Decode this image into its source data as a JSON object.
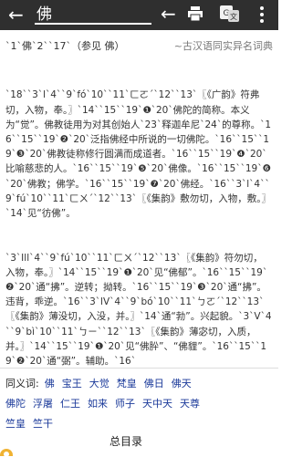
{
  "topbar": {
    "search_text": "佛",
    "back_label": "←",
    "nav_back_label": "←"
  },
  "header": {
    "headword": "`1`佛`2``17`（参见 佛）",
    "source": "~古汉语同实异名词典"
  },
  "content_lines": [
    "`18``3`l`4``9`fó`10``11`ㄈㄛˊ`12``13`〖《广韵》符弗切，入物，奉。〗`14``15``19`❶`20`佛陀的简称。本义为“觉”。佛教徒用为对其创始人`23`释迦牟尼`24`的尊称。`16``15``19`❷`20`泛指佛经中所说的一切佛陀。`16``15``19`❸`20`佛教徒称修行圆满而成道者。`16``15``19`❹`20`比喻慈悲的人。`16``15``19`❺`20`佛像。`16``15``19`❻`20`佛教；佛学。`16``15``19`❼`20`佛经。`16``3`l`4``9`fú`10``11`ㄈㄨˊ`12``13`〖《集韵》敷勿切，入物，敷。〗`14`见“彷佛”。",
    "`3`Ill`4``9`fú`10``11`ㄈㄨˊ`12``13`〖《集韵》符勿切，入物，奉。〗`14``15``19`❶`20`见“佛郁”。`16``15``19`❷`20`通“拂”。逆转；拗转。`16``15``19`❸`20`通“拂”。违背，乖逆。`16``3`lV`4``9`bó`10``11`ㄅㄛˊ`12``13`〖《集韵》薄没切，入没，并。〗`14`通“勃”。兴起貌。`3`V`4``9`bì`10``11`ㄅㄧˋ`12``13`〖《集韵》薄宓切，入质，并。〗`14``15``19`❶`20`见“佛肸”、“佛貍”。`16``15``19`❷`20`通“弼”。辅助。`16`"
  ],
  "synonyms": {
    "label": "同义词:",
    "row1": [
      "佛",
      "宝王",
      "大觉",
      "梵皇",
      "佛日",
      "佛天"
    ],
    "row2": [
      "佛陀",
      "浮屠",
      "仁王",
      "如来",
      "师子",
      "天中天",
      "天尊"
    ],
    "row3": [
      "竺皇",
      "竺干"
    ]
  },
  "footer": {
    "total_toc": "总目录"
  }
}
